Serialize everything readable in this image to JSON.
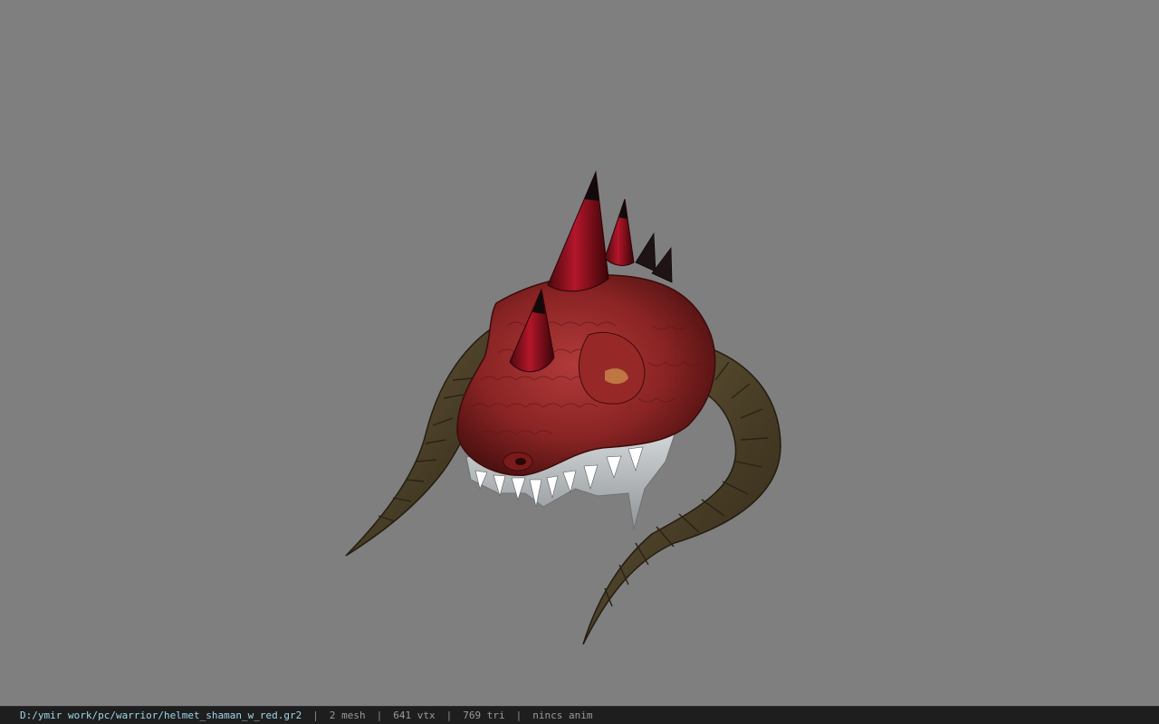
{
  "viewer": {
    "background_color": "#7f7f7f",
    "model_icon": "helmet-model"
  },
  "status_bar": {
    "file_path": "D:/ymir work/pc/warrior/helmet_shaman_w_red.gr2",
    "separator": "|",
    "mesh": "2 mesh",
    "vertices": "641 vtx",
    "triangles": "769 tri",
    "anim": "nincs anim",
    "path_color": "#9fd6ea",
    "bar_color": "#1e1e1e"
  }
}
